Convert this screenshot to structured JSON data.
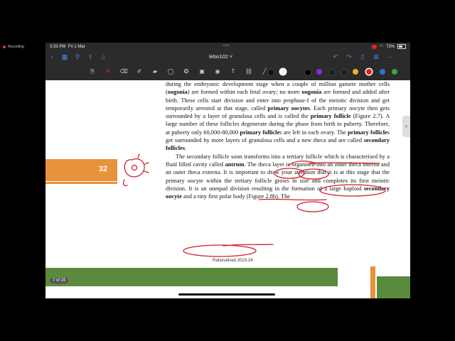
{
  "recording": {
    "label": "Recording"
  },
  "status_bar": {
    "time": "3:33 PM",
    "date": "Fri 1 Mar",
    "battery": "73%"
  },
  "nav": {
    "doc_title": "lebo102 ˅"
  },
  "page": {
    "page_number": "32",
    "paragraph1_lines": [
      "during the embryonic development stage when a couple of million gamete",
      "mother cells (oogonia) are formed within each fetal ovary; no more oogonia",
      "are formed and added after birth. These cells start division and enter into",
      "prophase-I of the meiotic division and get temporarily arrested at that stage,",
      "called primary oocytes. Each primary oocyte then gets surrounded by a",
      "layer of granulosa cells and is called the primary follicle (Figure 2.7). A",
      "large number of these follicles degenerate during the phase from birth to",
      "puberty. Therefore, at puberty only 60,000-80,000 primary follicles are",
      "left in each ovary. The primary follicles get surrounded by more layers of",
      "granulosa cells and a new theca and are called secondary follicles."
    ],
    "paragraph2_lines": [
      "The secondary follicle soon transforms into a tertiary follicle which is",
      "characterised by a fluid filled cavity called antrum. The theca layer is",
      "organised into an inner theca interna and an outer theca externa. It is",
      "important to draw your attention that it is at this stage that the primary",
      "oocyte within the tertiary follicle grows in size and completes its first meiotic",
      "division. It is an unequal division resulting in the formation of a large",
      "haploid secondary oocyte and a tiny first polar body (Figure 2.8b). The"
    ],
    "footer": "Rationalised 2023-24"
  },
  "bottom": {
    "page_counter": "7 of 15"
  },
  "colors": {
    "background": "#000000",
    "toolbar": "#2b2b2b",
    "accent_orange": "#e8923a",
    "ink_red": "#cc1f2a",
    "band_green": "#5a8a3c"
  },
  "icons": {
    "nav": [
      "back-icon",
      "grid-icon",
      "search-icon",
      "share-icon",
      "mic-icon",
      "undo-icon",
      "redo-icon",
      "bookmark-icon",
      "page-add-icon",
      "more-icon"
    ],
    "tools": [
      "text-recognition-icon",
      "pen-icon",
      "eraser-icon",
      "pencil-icon",
      "highlighter-icon",
      "lasso-icon",
      "shape-icon",
      "image-icon",
      "camera-icon",
      "textbox-icon",
      "link-icon",
      "ruler-icon"
    ],
    "swatches": [
      "#111111",
      "#f2f2f2",
      "#000000",
      "#8b2be2",
      "#1e1e1e",
      "#1e1e1e",
      "#f2b01e",
      "#e0211d",
      "#2e6fe0",
      "#3aa64a"
    ]
  }
}
